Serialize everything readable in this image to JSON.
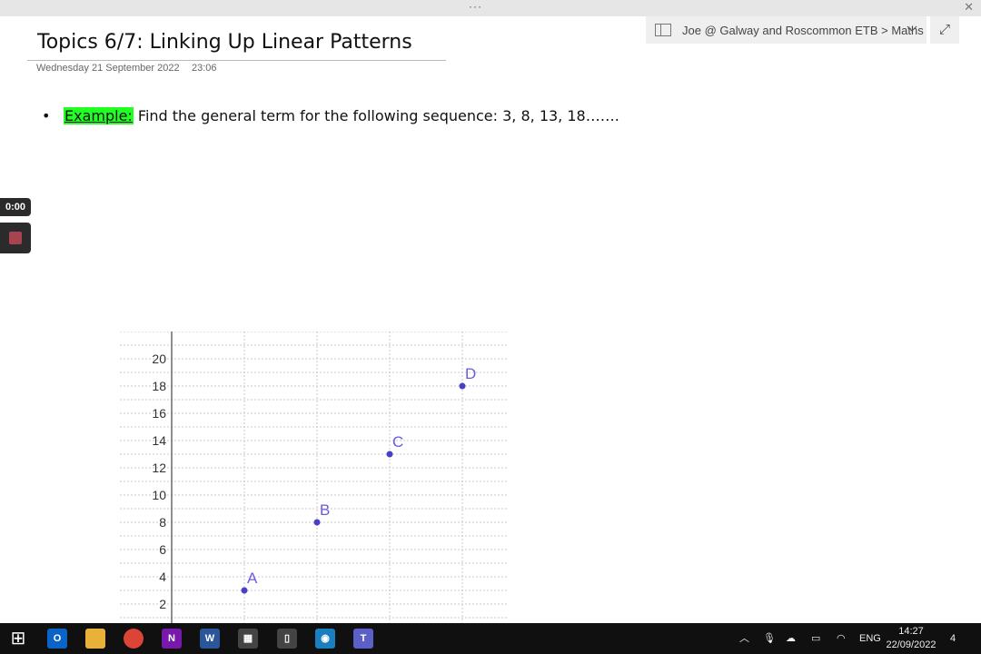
{
  "window": {
    "more_dots": "···",
    "close_glyph": "✕"
  },
  "notebook": {
    "path": "Joe @ Galway and Roscommon ETB > Maths",
    "expand_glyph": "⤢"
  },
  "page": {
    "title": "Topics 6/7: Linking Up Linear Patterns",
    "date": "Wednesday 21 September 2022",
    "time": "23:06",
    "bullet": "•",
    "example_label": "Example:",
    "example_text": " Find the general term for the following sequence: 3, 8, 13, 18……."
  },
  "recorder": {
    "elapsed": "0:00"
  },
  "chart_data": {
    "type": "scatter",
    "x": [
      1,
      2,
      3,
      4
    ],
    "y": [
      3,
      8,
      13,
      18
    ],
    "point_labels": [
      "A",
      "B",
      "C",
      "D"
    ],
    "y_ticks": [
      2,
      4,
      6,
      8,
      10,
      12,
      14,
      16,
      18,
      20
    ],
    "ylim": [
      0,
      22
    ],
    "xlim": [
      0,
      4.6
    ],
    "grid": true,
    "point_color": "#4a3fc4",
    "label_color": "#6a5ce0"
  },
  "taskbar": {
    "apps": [
      {
        "name": "windows-start-icon",
        "glyph": "⊞",
        "color": "#101010"
      },
      {
        "name": "outlook-icon",
        "glyph": "O",
        "color": "#0a64c8"
      },
      {
        "name": "file-explorer-icon",
        "glyph": "",
        "color": "#e8b13a"
      },
      {
        "name": "chrome-icon",
        "glyph": "",
        "color": "#db4437"
      },
      {
        "name": "onenote-icon",
        "glyph": "N",
        "color": "#7719aa"
      },
      {
        "name": "word-icon",
        "glyph": "W",
        "color": "#2b579a"
      },
      {
        "name": "calculator-icon",
        "glyph": "▦",
        "color": "#444444"
      },
      {
        "name": "phone-link-icon",
        "glyph": "▯",
        "color": "#444444"
      },
      {
        "name": "remote-app-icon",
        "glyph": "◉",
        "color": "#1a7fbf"
      },
      {
        "name": "teams-icon",
        "glyph": "T",
        "color": "#5b5fc7"
      }
    ],
    "tray": {
      "language": "ENG",
      "time": "14:27",
      "date": "22/09/2022",
      "notifications": "4"
    }
  }
}
